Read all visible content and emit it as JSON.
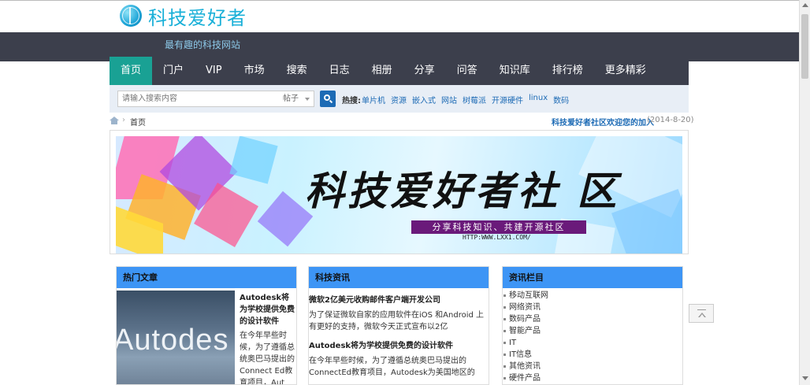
{
  "site": {
    "logo_text": "科技爱好者",
    "slogan": "最有趣的科技网站"
  },
  "nav": {
    "items": [
      {
        "label": "首页",
        "active": true
      },
      {
        "label": "门户"
      },
      {
        "label": "VIP"
      },
      {
        "label": "市场"
      },
      {
        "label": "搜索"
      },
      {
        "label": "日志"
      },
      {
        "label": "相册"
      },
      {
        "label": "分享"
      },
      {
        "label": "问答"
      },
      {
        "label": "知识库"
      },
      {
        "label": "排行榜"
      },
      {
        "label": "更多精彩"
      }
    ]
  },
  "search": {
    "placeholder": "请输入搜索内容",
    "type_selected": "帖子",
    "hot_label": "热搜:",
    "hot_links": [
      "单片机",
      "资源",
      "嵌入式",
      "网站",
      "树莓派",
      "开源硬件",
      "linux",
      "数码"
    ]
  },
  "breadcrumb": {
    "home": "首页",
    "separator": "›",
    "welcome": "科技爱好者社区欢迎您的加入",
    "date": "(2014-8-20)"
  },
  "banner": {
    "title": "科技爱好者社 区",
    "ribbon": "分享科技知识、共建开源社区",
    "url": "HTTP:WWW.LXX1.COM/"
  },
  "panels": {
    "hot": {
      "heading": "热门文章",
      "image_brand": "Autodes",
      "article_title": "Autodesk将为学校提供免费的设计软件",
      "article_body": "在今年早些时候，为了遵循总统奥巴马提出的Connect Ed教育项目，Aut"
    },
    "news": {
      "heading": "科技资讯",
      "items": [
        {
          "title": "微软2亿美元收购邮件客户端开发公司",
          "body": "为了保证微软自家的应用软件在iOS 和Android 上有更好的支持，微软今天正式宣布以2亿"
        },
        {
          "title": "Autodesk将为学校提供免费的设计软件",
          "body": "在今年早些时候，为了遵循总统奥巴马提出的ConnectEd教育项目，Autodesk为美国地区的"
        }
      ]
    },
    "columns": {
      "heading": "资讯栏目",
      "items": [
        "移动互联网",
        "网络资讯",
        "数码产品",
        "智能产品",
        "IT",
        "IT信息",
        "其他资讯",
        "硬件产品"
      ]
    }
  },
  "colors": {
    "nav_bg": "#3c3f4c",
    "nav_active": "#19a194",
    "panel_head": "#3d95f5",
    "link": "#1d6bb5",
    "logo": "#1ab0d8"
  }
}
